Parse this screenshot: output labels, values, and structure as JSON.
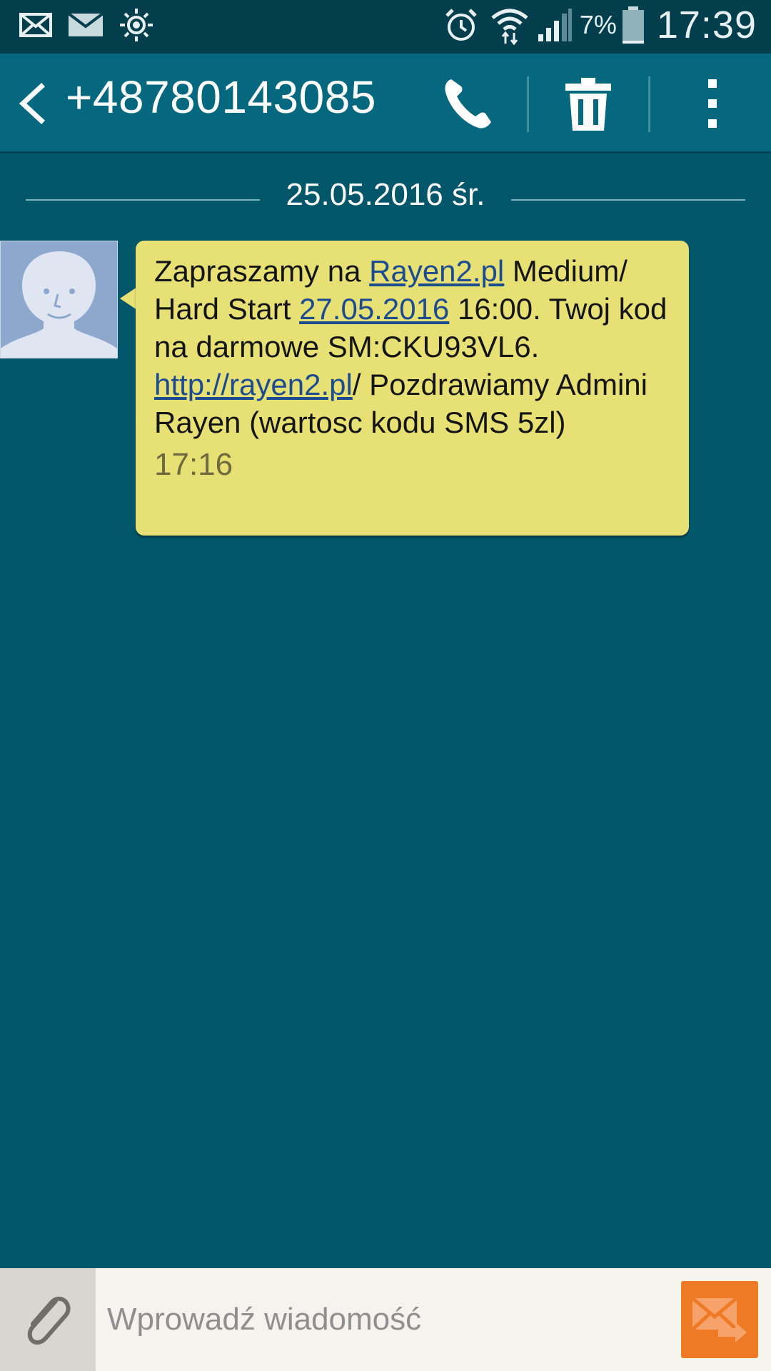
{
  "status_bar": {
    "icons_left": [
      "missed-message-icon",
      "mail-icon",
      "brightness-icon"
    ],
    "icons_right": [
      "alarm-icon",
      "wifi-icon",
      "signal-icon",
      "battery-icon"
    ],
    "battery_percent": "7%",
    "time": "17:39"
  },
  "header": {
    "title": "+48780143085",
    "actions": [
      "back-icon",
      "phone-icon",
      "trash-icon",
      "more-vert-icon"
    ]
  },
  "conversation": {
    "date_label": "25.05.2016 śr.",
    "message": {
      "segments": [
        {
          "text": "Zapraszamy na ",
          "link": false
        },
        {
          "text": "Rayen2.pl",
          "link": true
        },
        {
          "text": " Medium/ Hard Start ",
          "link": false
        },
        {
          "text": "27.05.2016",
          "link": true
        },
        {
          "text": " 16:00. Twoj kod na darmowe SM:CKU93VL6. ",
          "link": false
        },
        {
          "text": "http://rayen2.pl",
          "link": true
        },
        {
          "text": "/ Pozdrawiamy Admini Rayen (wartosc kodu SMS 5zl)",
          "link": false
        }
      ],
      "time": "17:16"
    }
  },
  "composer": {
    "placeholder": "Wprowadź wiadomość",
    "value": ""
  },
  "colors": {
    "background": "#02566a",
    "status_bar": "#023e4b",
    "action_bar": "#05687e",
    "bubble": "#e6e075",
    "link": "#1d4b8f",
    "send_button": "#ee7a26"
  }
}
